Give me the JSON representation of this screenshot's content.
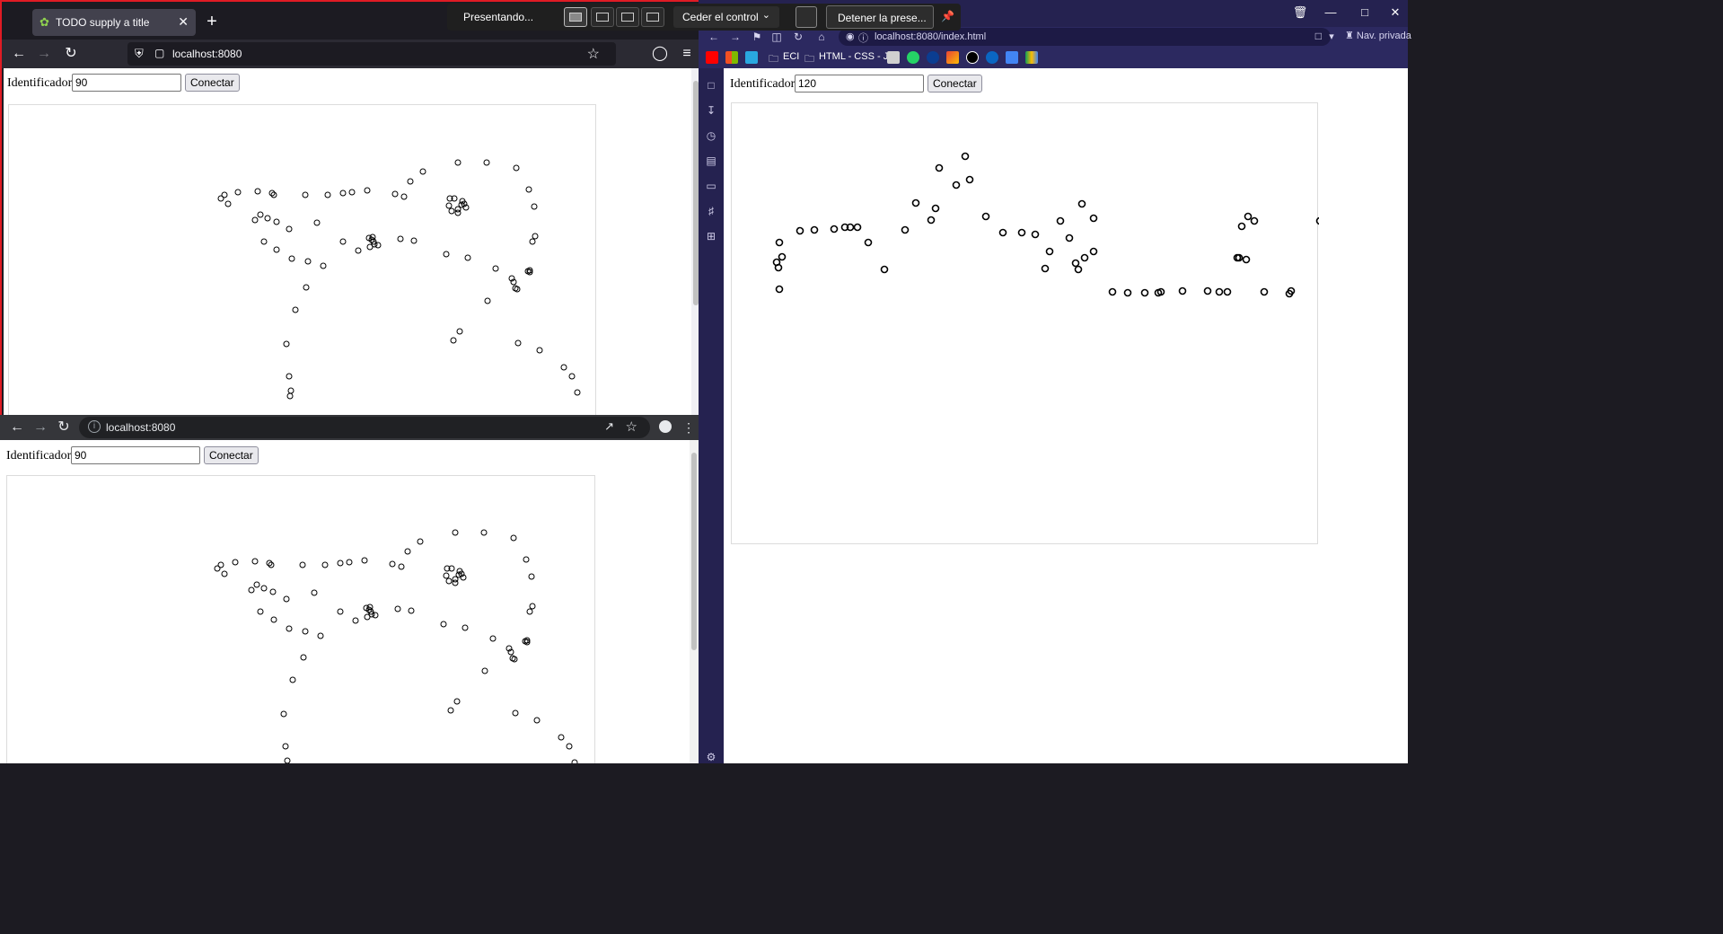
{
  "firefox": {
    "tab_title": "TODO supply a title",
    "url": "localhost:8080"
  },
  "chrome": {
    "url": "localhost:8080"
  },
  "edge": {
    "url": "localhost:8080/index.html",
    "private_label": "Nav. privada",
    "favorites": {
      "folder1": "ECI",
      "folder2": "HTML - CSS - JS"
    }
  },
  "presenting_bar": {
    "status": "Presentando...",
    "give_control": "Ceder el control",
    "stop": "Detener la prese..."
  },
  "form_left_top": {
    "label": "Identificador:",
    "value": "90",
    "button": "Conectar"
  },
  "form_left_bottom": {
    "label": "Identificador:",
    "value": "90",
    "button": "Conectar"
  },
  "form_right": {
    "label": "Identificador:",
    "value": "120",
    "button": "Conectar"
  },
  "colors": {
    "presenting_border": "#e01b24",
    "edge_private": "#252250",
    "point_stroke": "#000000"
  },
  "chart_data": [
    {
      "type": "scatter",
      "board": "left-top",
      "x": [
        236,
        240,
        244,
        255,
        277,
        293,
        295,
        330,
        355,
        372,
        382,
        399,
        430,
        440,
        447,
        461,
        500,
        532,
        565,
        579,
        585,
        586,
        583,
        580,
        274,
        280,
        288,
        298,
        312,
        343,
        372,
        389,
        401,
        404,
        406,
        411,
        407,
        402,
        405,
        436,
        451,
        487,
        511,
        542,
        560,
        562,
        564,
        566,
        578,
        580,
        331,
        319,
        309,
        312,
        314,
        313,
        333,
        350,
        315,
        298,
        284,
        496,
        490,
        493,
        500,
        505,
        500,
        491,
        507,
        504,
        509,
        533,
        567,
        591,
        618,
        627,
        633,
        502,
        495
      ],
      "y": [
        104,
        100,
        110,
        97,
        96,
        98,
        100,
        100,
        100,
        98,
        97,
        95,
        99,
        102,
        85,
        74,
        64,
        64,
        70,
        94,
        113,
        146,
        152,
        184,
        128,
        122,
        126,
        130,
        138,
        131,
        152,
        162,
        148,
        150,
        152,
        156,
        155,
        158,
        147,
        149,
        151,
        166,
        170,
        182,
        193,
        197,
        204,
        205,
        185,
        186,
        203,
        228,
        266,
        302,
        318,
        324,
        174,
        179,
        171,
        161,
        152,
        104,
        112,
        118,
        116,
        107,
        120,
        104,
        110,
        111,
        114,
        218,
        265,
        273,
        292,
        302,
        320,
        252,
        262
      ]
    },
    {
      "type": "scatter",
      "board": "left-bottom",
      "x": [
        234,
        238,
        242,
        254,
        276,
        292,
        294,
        329,
        354,
        371,
        381,
        398,
        429,
        439,
        446,
        460,
        499,
        531,
        564,
        578,
        584,
        585,
        582,
        579,
        272,
        278,
        286,
        296,
        311,
        342,
        371,
        388,
        400,
        403,
        405,
        410,
        406,
        401,
        404,
        435,
        450,
        486,
        510,
        541,
        559,
        561,
        563,
        565,
        577,
        579,
        330,
        318,
        308,
        310,
        312,
        311,
        332,
        349,
        314,
        297,
        282,
        495,
        489,
        492,
        499,
        504,
        499,
        490,
        506,
        503,
        508,
        532,
        566,
        590,
        617,
        626,
        632,
        501,
        494
      ],
      "y": [
        103,
        99,
        109,
        96,
        95,
        97,
        99,
        99,
        99,
        97,
        96,
        94,
        98,
        101,
        84,
        73,
        63,
        63,
        69,
        93,
        112,
        145,
        151,
        183,
        127,
        121,
        125,
        129,
        137,
        130,
        151,
        161,
        147,
        149,
        151,
        155,
        154,
        157,
        146,
        148,
        150,
        165,
        169,
        181,
        192,
        196,
        203,
        204,
        184,
        185,
        202,
        227,
        265,
        301,
        317,
        323,
        173,
        178,
        170,
        160,
        151,
        103,
        111,
        117,
        115,
        106,
        119,
        103,
        109,
        110,
        113,
        217,
        264,
        272,
        291,
        301,
        319,
        251,
        261
      ]
    },
    {
      "type": "scatter",
      "board": "right",
      "x": [
        53,
        56,
        50,
        52,
        53,
        76,
        92,
        114,
        126,
        132,
        140,
        152,
        170,
        193,
        222,
        227,
        205,
        231,
        250,
        265,
        260,
        283,
        302,
        323,
        338,
        349,
        354,
        366,
        376,
        383,
        386,
        390,
        393,
        403,
        403,
        424,
        441,
        460,
        475,
        478,
        502,
        530,
        543,
        552,
        563,
        565,
        568,
        573,
        575,
        582,
        593,
        621,
        623,
        655,
        687,
        700,
        728,
        739,
        742,
        750,
        755,
        744,
        726,
        753,
        758,
        726,
        737,
        761,
        742,
        754,
        760,
        765,
        754
      ],
      "y": [
        155,
        171,
        177,
        183,
        207,
        142,
        141,
        140,
        138,
        138,
        138,
        155,
        185,
        141,
        130,
        117,
        111,
        72,
        91,
        85,
        59,
        126,
        144,
        144,
        146,
        184,
        165,
        131,
        150,
        178,
        185,
        112,
        172,
        128,
        165,
        210,
        211,
        211,
        211,
        210,
        209,
        209,
        210,
        210,
        172,
        172,
        137,
        174,
        126,
        131,
        210,
        212,
        209,
        131,
        131,
        130,
        146,
        150,
        156,
        164,
        175,
        184,
        172,
        196,
        209,
        316,
        309,
        316,
        322,
        324,
        321,
        313,
        307
      ]
    }
  ]
}
